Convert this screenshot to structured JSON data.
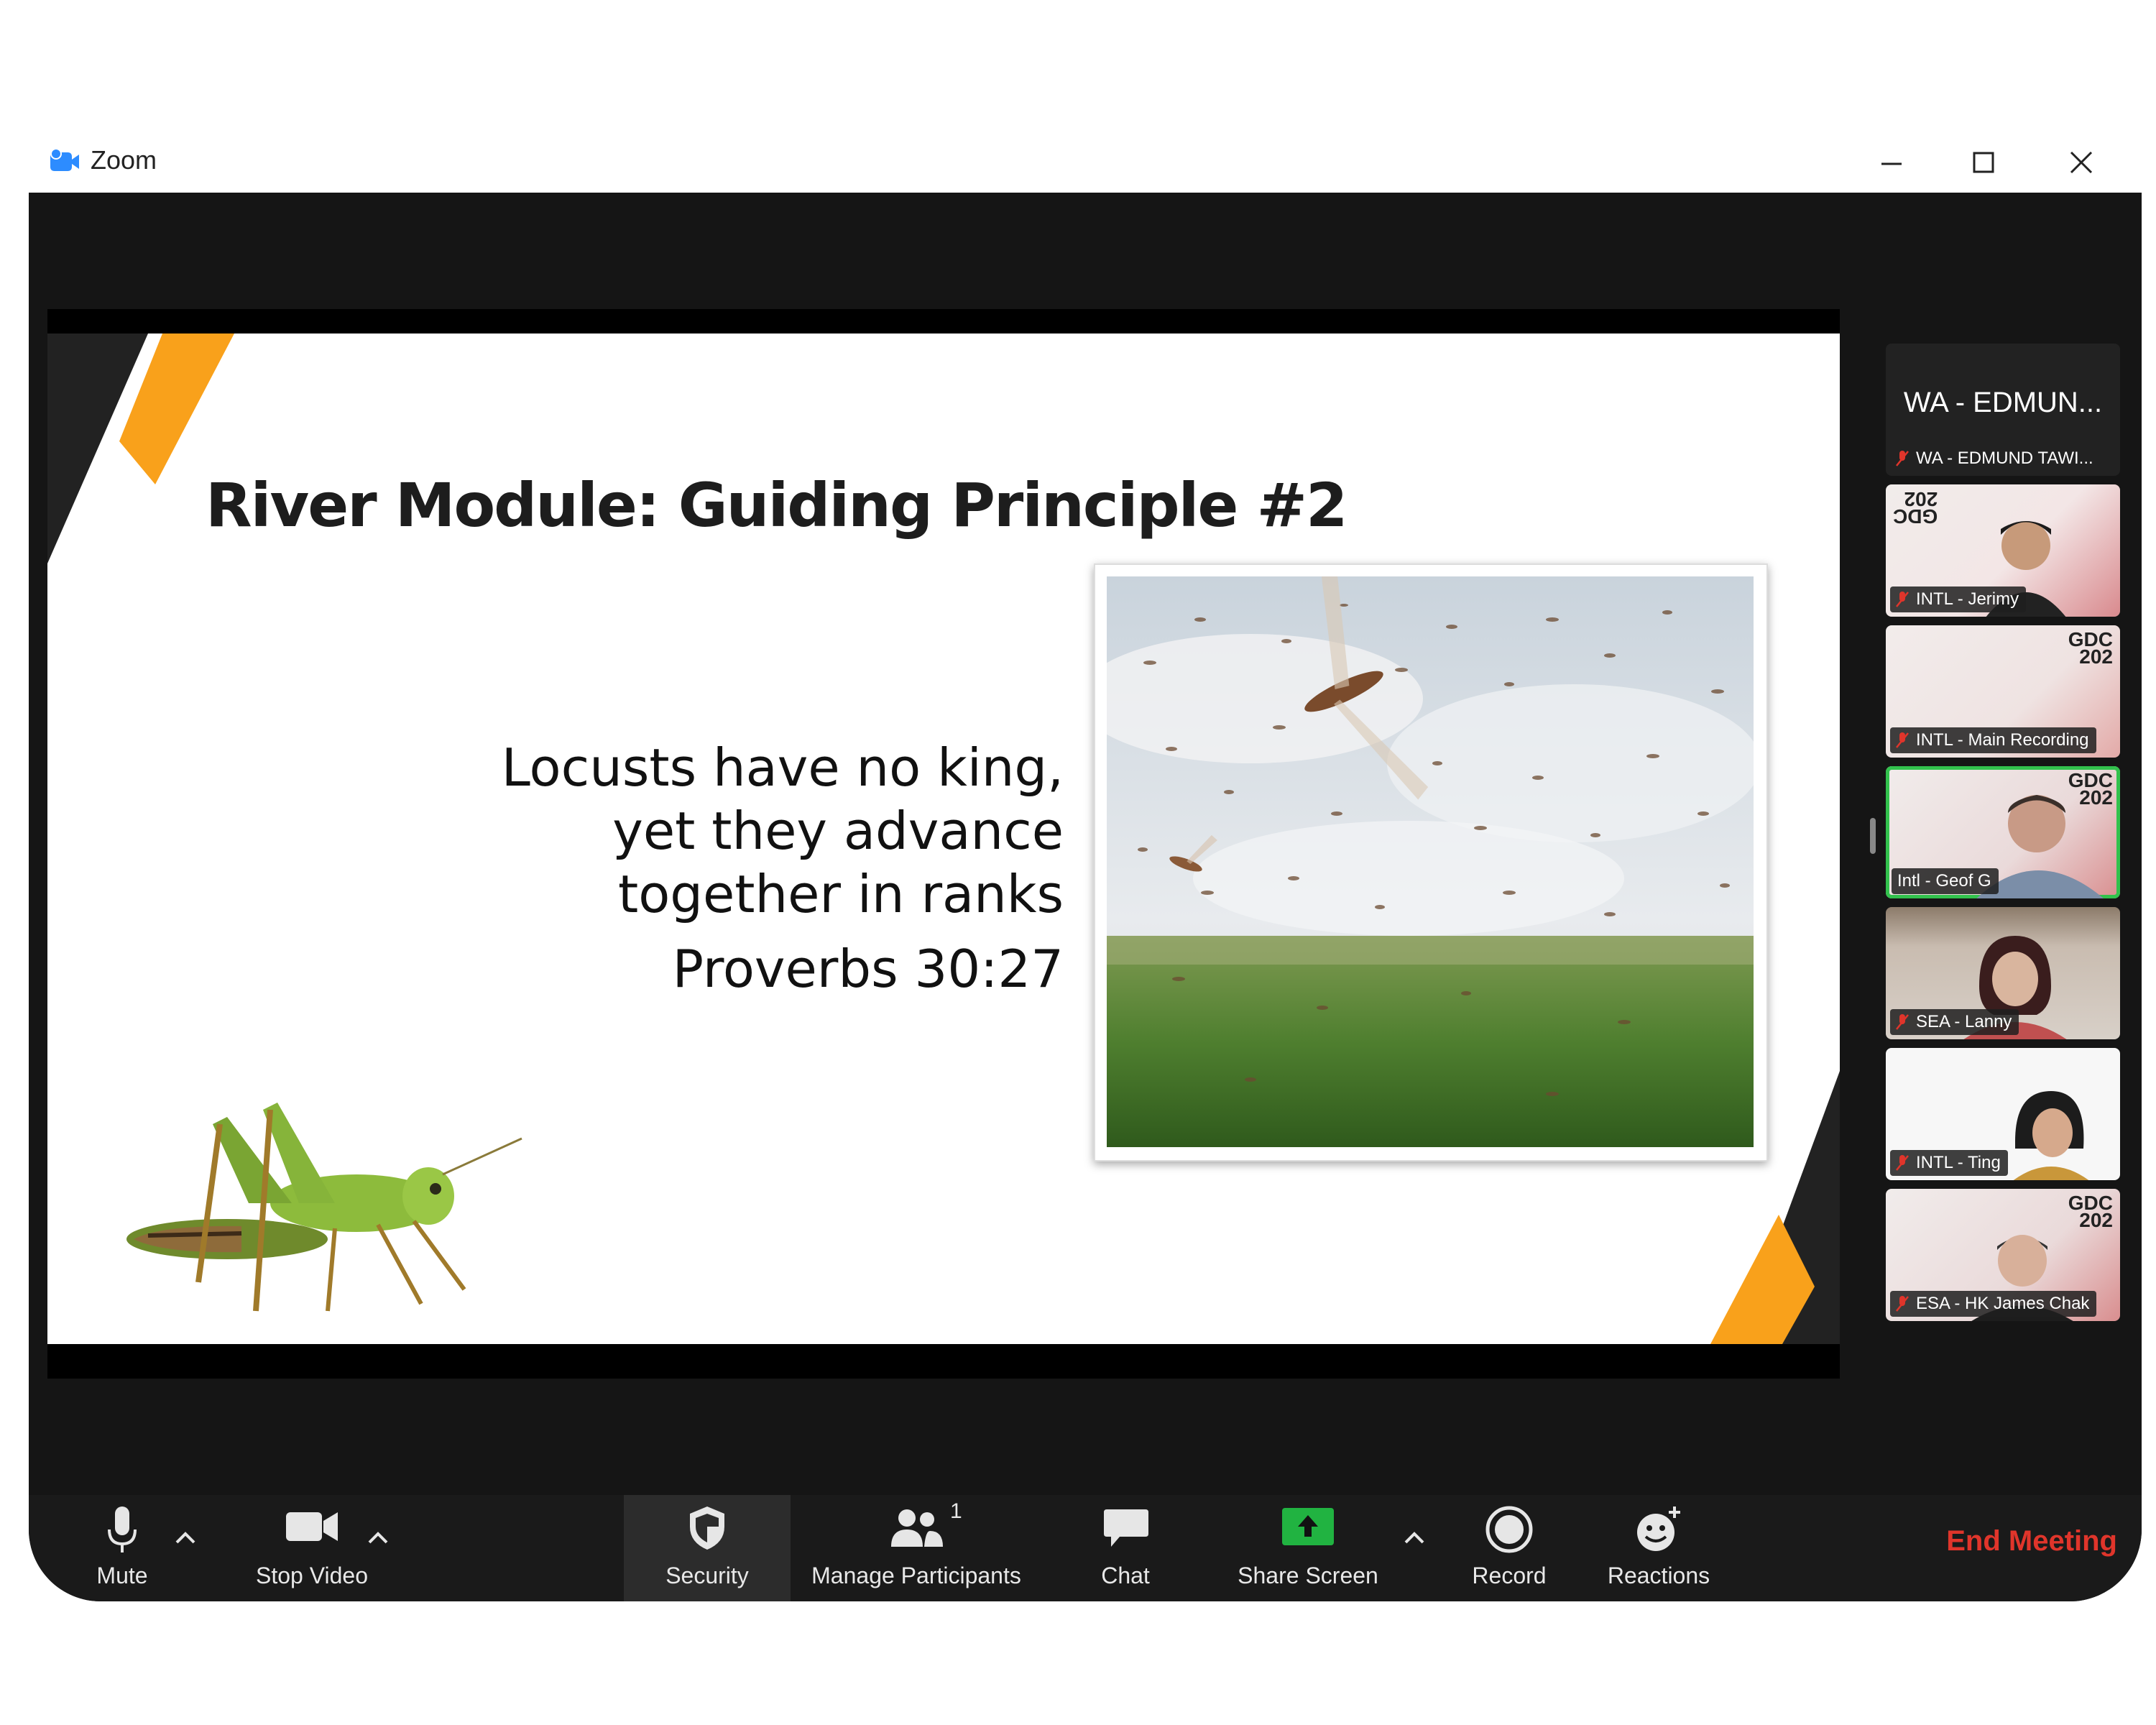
{
  "window": {
    "app_title": "Zoom"
  },
  "slide": {
    "title": "River Module: Guiding Principle #2",
    "quote_lines": [
      "Locusts have no king,",
      "yet they advance",
      "together in ranks"
    ],
    "reference": "Proverbs 30:27"
  },
  "participants": {
    "featured_name": "WA - EDMUN...",
    "featured_label": "WA - EDMUND TAWI...",
    "tiles": [
      {
        "name": "INTL - Jerimy",
        "muted": true
      },
      {
        "name": "INTL - Main Recording",
        "muted": true
      },
      {
        "name": "Intl - Geof G",
        "muted": false
      },
      {
        "name": "SEA - Lanny",
        "muted": true
      },
      {
        "name": "INTL - Ting",
        "muted": true
      },
      {
        "name": "ESA - HK James Chak",
        "muted": true
      }
    ],
    "logo_text": [
      "GDC",
      "202"
    ]
  },
  "toolbar": {
    "mute": "Mute",
    "stop_video": "Stop Video",
    "security": "Security",
    "manage_participants": "Manage Participants",
    "participant_count": "1",
    "chat": "Chat",
    "share_screen": "Share Screen",
    "record": "Record",
    "reactions": "Reactions",
    "end_meeting": "End Meeting"
  },
  "colors": {
    "accent_orange": "#f9a11b",
    "share_green": "#21b341",
    "end_red": "#e0352b",
    "active_speaker": "#32c24d"
  }
}
